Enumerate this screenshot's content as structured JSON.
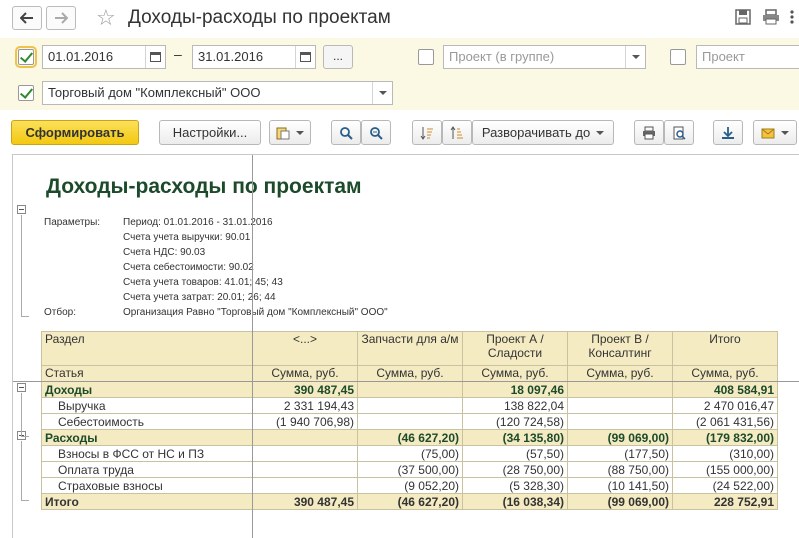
{
  "window": {
    "title": "Доходы-расходы по проектам"
  },
  "filters": {
    "period_from": "01.01.2016",
    "period_to": "31.01.2016",
    "period_dash": "–",
    "more_button": "...",
    "project_group_placeholder": "Проект (в группе)",
    "project_placeholder": "Проект",
    "organization": "Торговый дом \"Комплексный\" ООО",
    "period_checked": true,
    "organization_checked": true,
    "project_group_checked": false,
    "project_checked": false
  },
  "toolbar": {
    "generate_label": "Сформировать",
    "settings_label": "Настройки...",
    "expand_label": "Разворачивать до"
  },
  "report": {
    "title": "Доходы-расходы по проектам",
    "params_label": "Параметры:",
    "params": [
      "Период: 01.01.2016 - 31.01.2016",
      "Счета учета выручки: 90.01",
      "Счета НДС: 90.03",
      "Счета себестоимости: 90.02",
      "Счета учета товаров: 41.01; 45; 43",
      "Счета учета затрат: 20.01; 26; 44"
    ],
    "filter_label": "Отбор:",
    "filter_value": "Организация Равно \"Торговый дом \"Комплексный\" ООО\"",
    "header": {
      "section": "Раздел",
      "article": "Статья",
      "columns": [
        "<...>",
        "Запчасти для а/м",
        "Проект А / Сладости",
        "Проект В / Консалтинг",
        "Итого"
      ],
      "unit": "Сумма, руб."
    },
    "rows": [
      {
        "label": "Доходы",
        "type": "grp",
        "values": [
          "390 487,45",
          "",
          "18 097,46",
          "",
          "408 584,91"
        ]
      },
      {
        "label": "Выручка",
        "type": "item",
        "values": [
          "2 331 194,43",
          "",
          "138 822,04",
          "",
          "2 470 016,47"
        ]
      },
      {
        "label": "Себестоимость",
        "type": "item",
        "values": [
          "(1 940 706,98)",
          "",
          "(120 724,58)",
          "",
          "(2 061 431,56)"
        ]
      },
      {
        "label": "Расходы",
        "type": "grp",
        "values": [
          "",
          "(46 627,20)",
          "(34 135,80)",
          "(99 069,00)",
          "(179 832,00)"
        ]
      },
      {
        "label": "Взносы в ФСС от НС и ПЗ",
        "type": "item",
        "values": [
          "",
          "(75,00)",
          "(57,50)",
          "(177,50)",
          "(310,00)"
        ]
      },
      {
        "label": "Оплата труда",
        "type": "item",
        "values": [
          "",
          "(37 500,00)",
          "(28 750,00)",
          "(88 750,00)",
          "(155 000,00)"
        ]
      },
      {
        "label": "Страховые взносы",
        "type": "item",
        "values": [
          "",
          "(9 052,20)",
          "(5 328,30)",
          "(10 141,50)",
          "(24 522,00)"
        ]
      },
      {
        "label": "Итого",
        "type": "tot",
        "values": [
          "390 487,45",
          "(46 627,20)",
          "(16 038,34)",
          "(99 069,00)",
          "228 752,91"
        ]
      }
    ]
  },
  "icons": {
    "back": "arrow-left-icon",
    "forward": "arrow-right-icon",
    "favorite": "star-icon",
    "save": "floppy-icon",
    "print": "printer-icon",
    "more": "more-vertical-icon"
  }
}
